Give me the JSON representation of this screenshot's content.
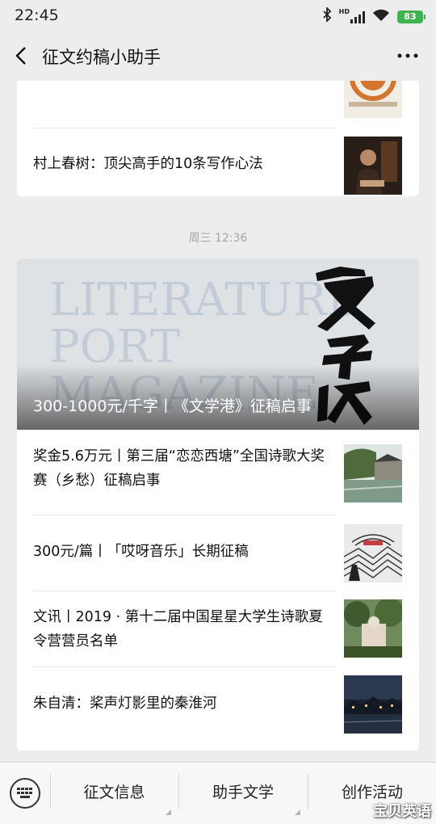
{
  "status_bar": {
    "time": "22:45",
    "network": "HD",
    "battery": "83"
  },
  "nav": {
    "title": "征文约稿小助手"
  },
  "card1": {
    "items": [
      {
        "title": "村上春树：顶尖高手的10条写作心法"
      }
    ]
  },
  "timestamp": "周三 12:36",
  "card2": {
    "cover_title": "300-1000元/千字丨《文学港》征稿启事",
    "items": [
      {
        "title": "奖金5.6万元丨第三届“恋恋西塘”全国诗歌大奖赛（乡愁）征稿启事"
      },
      {
        "title": "300元/篇丨「哎呀音乐」长期征稿"
      },
      {
        "title": "文讯丨2019 · 第十二届中国星星大学生诗歌夏令营营员名单"
      },
      {
        "title": "朱自清：桨声灯影里的秦淮河"
      }
    ]
  },
  "bottom_menu": {
    "items": [
      {
        "label": "征文信息"
      },
      {
        "label": "助手文学"
      },
      {
        "label": "创作活动"
      }
    ]
  },
  "colors": {
    "battery": "#3fb34f",
    "page_bg": "#ededed",
    "card_bg": "#ffffff"
  }
}
